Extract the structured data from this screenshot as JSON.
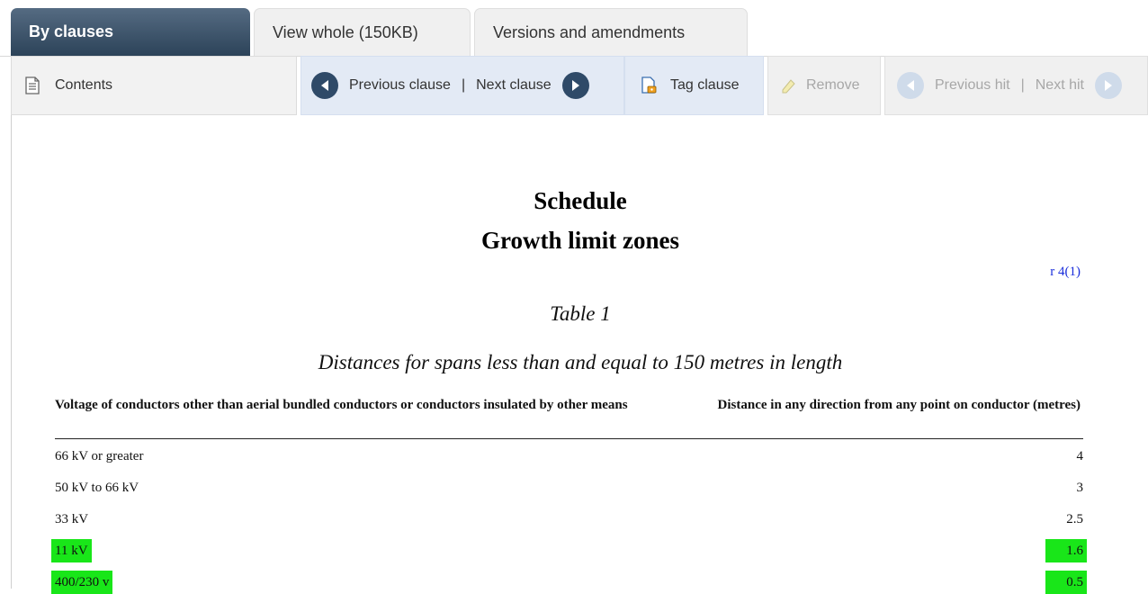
{
  "tabs": {
    "by_clauses": "By clauses",
    "view_whole": "View whole (150KB)",
    "versions": "Versions and amendments"
  },
  "toolbar": {
    "contents": "Contents",
    "previous_clause": "Previous clause",
    "separator": "|",
    "next_clause": "Next clause",
    "tag_clause": "Tag clause",
    "remove": "Remove",
    "previous_hit": "Previous hit",
    "next_hit": "Next hit"
  },
  "document": {
    "heading": "Schedule",
    "subheading": "Growth limit zones",
    "reference": "r 4(1)",
    "table_title": "Table 1",
    "table_subtitle": "Distances for spans less than and equal to 150 metres in length",
    "col_left": "Voltage of conductors other than aerial bundled conductors or conductors insulated by other means",
    "col_right": "Distance in any direction from any point on conductor (metres)",
    "rows": [
      {
        "voltage": "66 kV or greater",
        "distance": "4"
      },
      {
        "voltage": "50 kV to 66 kV",
        "distance": "3"
      },
      {
        "voltage": "33 kV",
        "distance": "2.5"
      },
      {
        "voltage": "11 kV",
        "distance": "1.6"
      },
      {
        "voltage": "400/230 v",
        "distance": "0.5"
      }
    ]
  },
  "colors": {
    "active_tab": "#2c4359",
    "highlight": "#19e619",
    "link": "#1a2edb"
  }
}
